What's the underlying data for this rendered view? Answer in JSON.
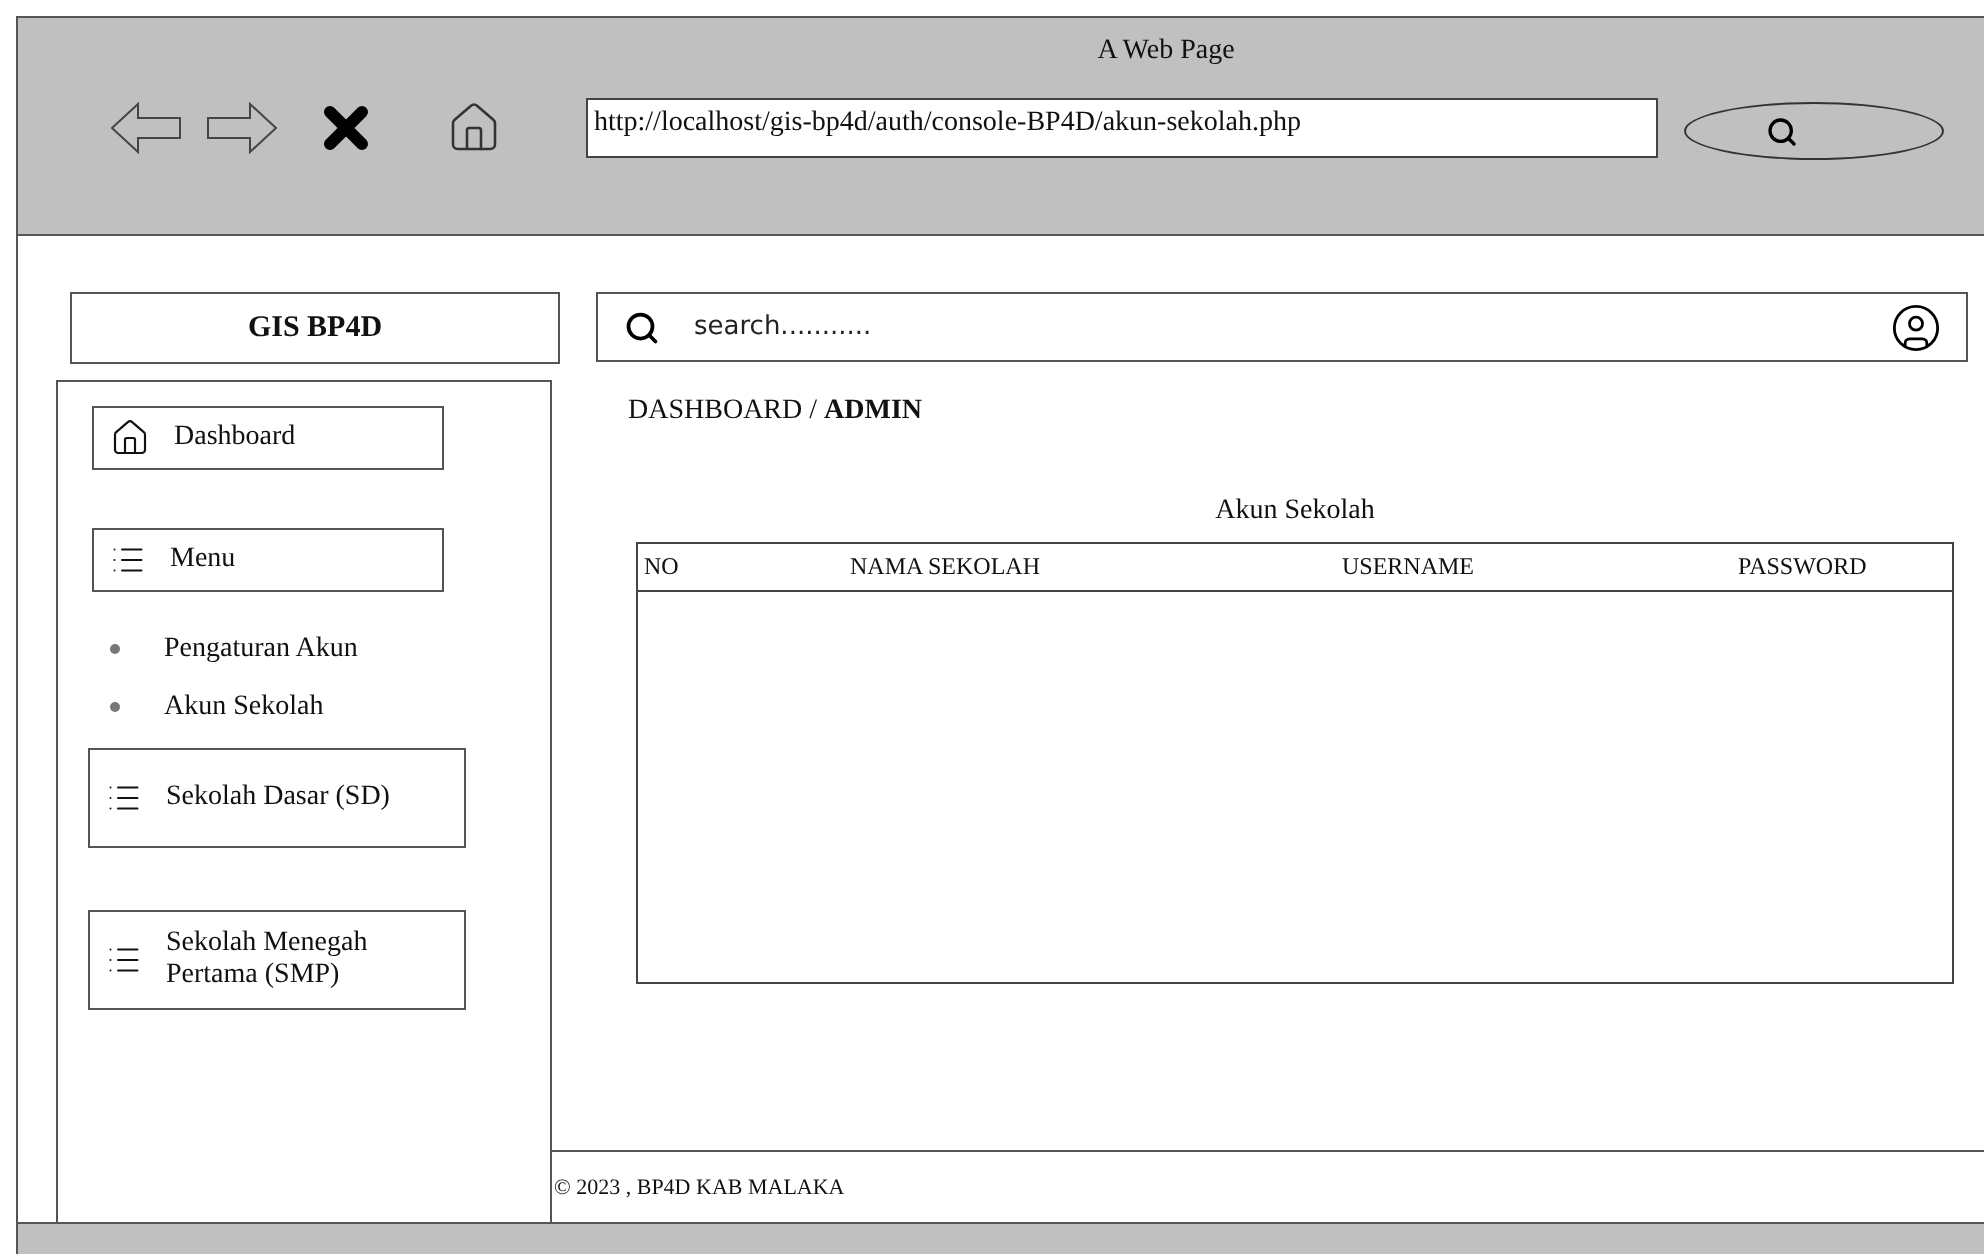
{
  "window": {
    "title": "A Web Page",
    "address": "http://localhost/gis-bp4d/auth/console-BP4D/akun-sekolah.php"
  },
  "brand": "GIS BP4D",
  "sidebar": {
    "items": [
      {
        "kind": "home",
        "label": "Dashboard"
      },
      {
        "kind": "menu",
        "label": "Menu"
      },
      {
        "kind": "bullet",
        "label": "Pengaturan Akun"
      },
      {
        "kind": "bullet",
        "label": "Akun Sekolah"
      },
      {
        "kind": "group",
        "label": "Sekolah Dasar (SD)"
      },
      {
        "kind": "group",
        "label": "Sekolah Menegah Pertama (SMP)"
      }
    ]
  },
  "search": {
    "placeholder": "search..........."
  },
  "breadcrumb": "DASHBOARD / **ADMIN**",
  "table": {
    "title": "Akun Sekolah",
    "columns": [
      "NO",
      "NAMA SEKOLAH",
      "USERNAME",
      "PASSWORD"
    ]
  },
  "footer": "© 2023 , BP4D KAB MALAKA"
}
